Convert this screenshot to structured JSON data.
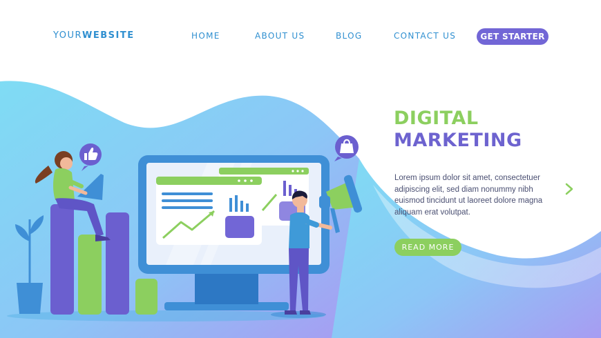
{
  "nav": {
    "logo_prefix": "YOUR",
    "logo_bold": "WEBSITE",
    "links": [
      "HOME",
      "ABOUT US",
      "BLOG",
      "CONTACT US"
    ],
    "cta": "GET STARTER"
  },
  "hero": {
    "title_line1": "DIGITAL",
    "title_line2": "MARKETING",
    "description": "Lorem ipsum dolor sit amet, consectetuer adipiscing elit, sed diam nonummy nibh euismod tincidunt ut laoreet dolore magna aliquam erat volutpat.",
    "read_more": "READ MORE"
  },
  "colors": {
    "accent_purple": "#7266d6",
    "accent_green": "#8ccf5f",
    "nav_blue": "#2f8fd0",
    "text_dark": "#4a4f72"
  },
  "icons": [
    "thumbs-up-icon",
    "shopping-bag-icon",
    "chevron-right-icon",
    "megaphone-icon"
  ]
}
